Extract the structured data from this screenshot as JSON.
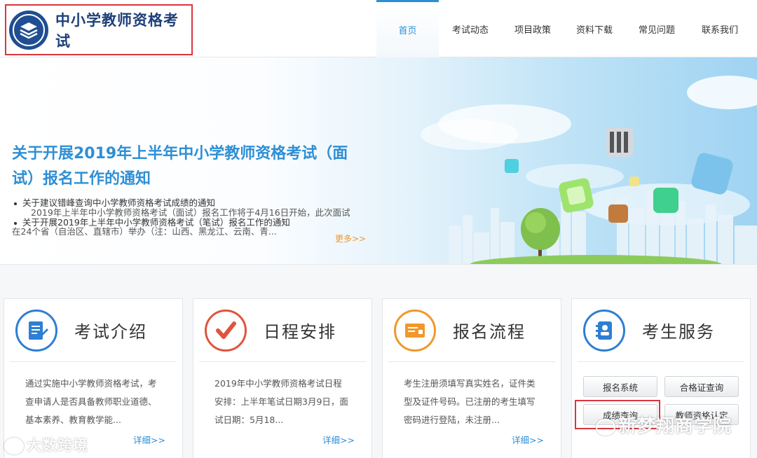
{
  "header": {
    "logo_title": "中小学教师资格考试",
    "nav": [
      {
        "label": "首页",
        "active": true
      },
      {
        "label": "考试动态",
        "active": false
      },
      {
        "label": "项目政策",
        "active": false
      },
      {
        "label": "资料下载",
        "active": false
      },
      {
        "label": "常见问题",
        "active": false
      },
      {
        "label": "联系我们",
        "active": false
      }
    ]
  },
  "banner": {
    "notice_title": "关于开展2019年上半年中小学教师资格考试（面试）报名工作的通知",
    "notice_summary": "2019年上半年中小学教师资格考试（面试）报名工作将于4月16日开始，此次面试在24个省（自治区、直辖市）举办（注：山西、黑龙江、云南、青...",
    "links": [
      "关于建议错峰查询中小学教师资格考试成绩的通知",
      "关于开展2019年上半年中小学教师资格考试（笔试）报名工作的通知"
    ],
    "more": "更多>>"
  },
  "cards": [
    {
      "title": "考试介绍",
      "icon": "document-icon",
      "body": "通过实施中小学教师资格考试，考查申请人是否具备教师职业道德、基本素养、教育教学能...",
      "detail": "详细>>"
    },
    {
      "title": "日程安排",
      "icon": "checkmark-icon",
      "body": "2019年中小学教师资格考试日程安排：上半年笔试日期3月9日，面试日期：5月18...",
      "detail": "详细>>"
    },
    {
      "title": "报名流程",
      "icon": "form-icon",
      "body": "考生注册须填写真实姓名，证件类型及证件号码。已注册的考生填写密码进行登陆，未注册...",
      "detail": "详细>>"
    },
    {
      "title": "考生服务",
      "icon": "contacts-icon"
    }
  ],
  "services": {
    "buttons": [
      "报名系统",
      "合格证查询",
      "成绩查询",
      "教师资格认定"
    ]
  },
  "watermarks": {
    "left": "大数跨境",
    "right": "新梦翔商学院"
  },
  "colors": {
    "brand_blue": "#2b8fd6",
    "logo_navy": "#1e3f7a",
    "highlight_red": "#d9363e",
    "more_orange": "#f0982b",
    "check_red": "#e0543e",
    "form_orange": "#f0982b"
  }
}
